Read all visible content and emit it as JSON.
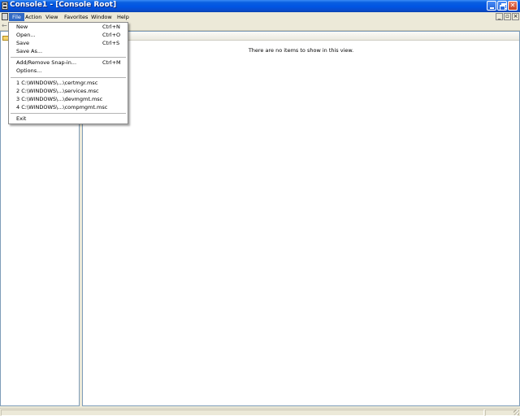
{
  "window": {
    "title": "Console1 - [Console Root]"
  },
  "menubar": {
    "items": [
      "File",
      "Action",
      "View",
      "Favorites",
      "Window",
      "Help"
    ]
  },
  "file_menu": {
    "items": [
      {
        "label": "New",
        "shortcut": "Ctrl+N"
      },
      {
        "label": "Open...",
        "shortcut": "Ctrl+O"
      },
      {
        "label": "Save",
        "shortcut": "Ctrl+S"
      },
      {
        "label": "Save As...",
        "shortcut": ""
      },
      {
        "label": "Add/Remove Snap-in...",
        "shortcut": "Ctrl+M"
      },
      {
        "label": "Options...",
        "shortcut": ""
      },
      {
        "label": "1 C:\\WINDOWS\\...\\certmgr.msc",
        "shortcut": ""
      },
      {
        "label": "2 C:\\WINDOWS\\...\\services.msc",
        "shortcut": ""
      },
      {
        "label": "3 C:\\WINDOWS\\...\\devmgmt.msc",
        "shortcut": ""
      },
      {
        "label": "4 C:\\WINDOWS\\...\\compmgmt.msc",
        "shortcut": ""
      },
      {
        "label": "Exit",
        "shortcut": ""
      }
    ]
  },
  "list_pane": {
    "empty_message": "There are no items to show in this view."
  },
  "icons": {
    "app": "mmc-console-icon",
    "folder": "folder-icon",
    "back": "back-arrow-icon"
  },
  "colors": {
    "titlebar": "#0054E3",
    "menu_highlight": "#316AC5",
    "close_button": "#C4401F"
  }
}
